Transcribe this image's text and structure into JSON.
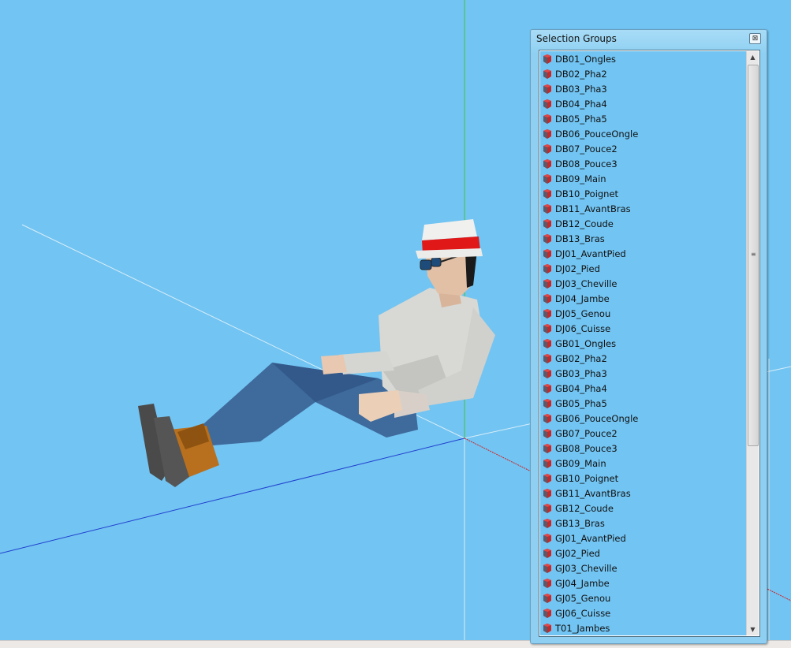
{
  "panel": {
    "title": "Selection Groups",
    "close_label": "⊠",
    "items": [
      "DB01_Ongles",
      "DB02_Pha2",
      "DB03_Pha3",
      "DB04_Pha4",
      "DB05_Pha5",
      "DB06_PouceOngle",
      "DB07_Pouce2",
      "DB08_Pouce3",
      "DB09_Main",
      "DB10_Poignet",
      "DB11_AvantBras",
      "DB12_Coude",
      "DB13_Bras",
      "DJ01_AvantPied",
      "DJ02_Pied",
      "DJ03_Cheville",
      "DJ04_Jambe",
      "DJ05_Genou",
      "DJ06_Cuisse",
      "GB01_Ongles",
      "GB02_Pha2",
      "GB03_Pha3",
      "GB04_Pha4",
      "GB05_Pha5",
      "GB06_PouceOngle",
      "GB07_Pouce2",
      "GB08_Pouce3",
      "GB09_Main",
      "GB10_Poignet",
      "GB11_AvantBras",
      "GB12_Coude",
      "GB13_Bras",
      "GJ01_AvantPied",
      "GJ02_Pied",
      "GJ03_Cheville",
      "GJ04_Jambe",
      "GJ05_Genou",
      "GJ06_Cuisse",
      "T01_Jambes"
    ],
    "scroll_up": "▲",
    "scroll_down": "▼",
    "grip": "≡"
  },
  "colors": {
    "background": "#72c4f2",
    "axis_x": "#d42020",
    "axis_y": "#3ec43e",
    "axis_z": "#2040d0"
  }
}
